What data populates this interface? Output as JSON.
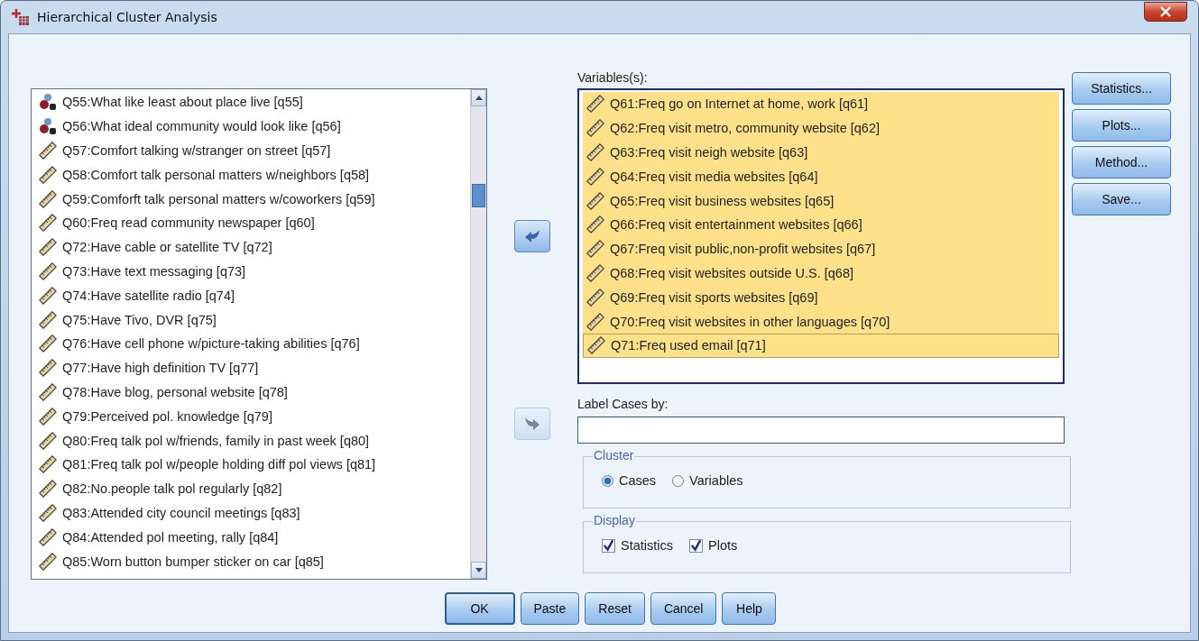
{
  "window": {
    "title": "Hierarchical Cluster Analysis"
  },
  "source_list": {
    "items": [
      {
        "kind": "nominal",
        "label": "Q55:What like least about place live [q55]",
        "selected": false
      },
      {
        "kind": "nominal",
        "label": "Q56:What ideal community would look like [q56]",
        "selected": false
      },
      {
        "kind": "scale",
        "label": "Q57:Comfort talking w/stranger on street [q57]",
        "selected": false
      },
      {
        "kind": "scale",
        "label": "Q58:Comfort talk personal matters w/neighbors [q58]",
        "selected": false
      },
      {
        "kind": "scale",
        "label": "Q59:Comforft talk personal matters w/coworkers [q59]",
        "selected": false
      },
      {
        "kind": "scale",
        "label": "Q60:Freq read community newspaper [q60]",
        "selected": false
      },
      {
        "kind": "scale",
        "label": "Q72:Have cable or satellite TV [q72]",
        "selected": false
      },
      {
        "kind": "scale",
        "label": "Q73:Have text messaging [q73]",
        "selected": false
      },
      {
        "kind": "scale",
        "label": "Q74:Have satellite radio [q74]",
        "selected": false
      },
      {
        "kind": "scale",
        "label": "Q75:Have Tivo, DVR [q75]",
        "selected": false
      },
      {
        "kind": "scale",
        "label": "Q76:Have cell phone w/picture-taking abilities [q76]",
        "selected": false
      },
      {
        "kind": "scale",
        "label": "Q77:Have high definition TV [q77]",
        "selected": false
      },
      {
        "kind": "scale",
        "label": "Q78:Have blog, personal website [q78]",
        "selected": false
      },
      {
        "kind": "scale",
        "label": "Q79:Perceived pol. knowledge [q79]",
        "selected": false
      },
      {
        "kind": "scale",
        "label": "Q80:Freq talk pol w/friends, family in past week [q80]",
        "selected": false
      },
      {
        "kind": "scale",
        "label": "Q81:Freq talk pol w/people holding diff pol views [q81]",
        "selected": false
      },
      {
        "kind": "scale",
        "label": "Q82:No.people talk pol regularly [q82]",
        "selected": false
      },
      {
        "kind": "scale",
        "label": "Q83:Attended city council meetings [q83]",
        "selected": false
      },
      {
        "kind": "scale",
        "label": "Q84:Attended pol meeting, rally [q84]",
        "selected": false
      },
      {
        "kind": "scale",
        "label": "Q85:Worn button bumper sticker on car [q85]",
        "selected": false
      }
    ]
  },
  "move_buttons": [
    {
      "kind": "left",
      "disabled": false
    },
    {
      "kind": "right",
      "disabled": true
    }
  ],
  "variables": {
    "label": "Variables(s):",
    "items": [
      {
        "kind": "scale",
        "label": "Q61:Freq go on Internet at home, work [q61]",
        "selected": true,
        "focused": false
      },
      {
        "kind": "scale",
        "label": "Q62:Freq visit metro, community website [q62]",
        "selected": true,
        "focused": false
      },
      {
        "kind": "scale",
        "label": "Q63:Freq visit neigh website [q63]",
        "selected": true,
        "focused": false
      },
      {
        "kind": "scale",
        "label": "Q64:Freq visit media websites [q64]",
        "selected": true,
        "focused": false
      },
      {
        "kind": "scale",
        "label": "Q65:Freq visit business websites [q65]",
        "selected": true,
        "focused": false
      },
      {
        "kind": "scale",
        "label": "Q66:Freq visit entertainment websites [q66]",
        "selected": true,
        "focused": false
      },
      {
        "kind": "scale",
        "label": "Q67:Freq visit public,non-profit websites [q67]",
        "selected": true,
        "focused": false
      },
      {
        "kind": "scale",
        "label": "Q68:Freq visit websites outside U.S. [q68]",
        "selected": true,
        "focused": false
      },
      {
        "kind": "scale",
        "label": "Q69:Freq visit sports websites [q69]",
        "selected": true,
        "focused": false
      },
      {
        "kind": "scale",
        "label": "Q70:Freq visit websites in other languages [q70]",
        "selected": true,
        "focused": false
      },
      {
        "kind": "scale",
        "label": "Q71:Freq used email [q71]",
        "selected": true,
        "focused": true
      }
    ]
  },
  "label_cases": {
    "label": "Label Cases by:"
  },
  "cluster": {
    "title": "Cluster",
    "options": [
      {
        "label": "Cases",
        "selected": true
      },
      {
        "label": "Variables",
        "selected": false
      }
    ]
  },
  "display": {
    "title": "Display",
    "options": [
      {
        "label": "Statistics",
        "checked": true
      },
      {
        "label": "Plots",
        "checked": true
      }
    ]
  },
  "side_buttons": [
    "Statistics...",
    "Plots...",
    "Method...",
    "Save..."
  ],
  "buttons": [
    {
      "label": "OK",
      "default": true
    },
    {
      "label": "Paste",
      "default": false
    },
    {
      "label": "Reset",
      "default": false
    },
    {
      "label": "Cancel",
      "default": false
    },
    {
      "label": "Help",
      "default": false
    }
  ]
}
